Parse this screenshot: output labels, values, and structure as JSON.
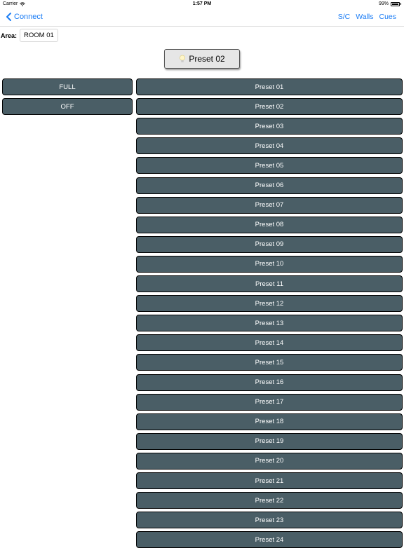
{
  "status_bar": {
    "carrier": "Carrier",
    "time": "1:57 PM",
    "battery": "99%"
  },
  "nav": {
    "back_label": "Connect",
    "right_items": [
      "S/C",
      "Walls",
      "Cues"
    ]
  },
  "area": {
    "label": "Area:",
    "value": "ROOM 01"
  },
  "current_preset": "Preset 02",
  "left_buttons": [
    "FULL",
    "OFF"
  ],
  "presets": [
    "Preset 01",
    "Preset 02",
    "Preset 03",
    "Preset 04",
    "Preset 05",
    "Preset 06",
    "Preset 07",
    "Preset 08",
    "Preset 09",
    "Preset 10",
    "Preset 11",
    "Preset 12",
    "Preset 13",
    "Preset 14",
    "Preset 15",
    "Preset 16",
    "Preset 17",
    "Preset 18",
    "Preset 19",
    "Preset 20",
    "Preset 21",
    "Preset 22",
    "Preset 23",
    "Preset 24"
  ],
  "colors": {
    "accent": "#1a7cf5",
    "button_bg": "#4a5e66",
    "button_text": "#ffffff"
  }
}
